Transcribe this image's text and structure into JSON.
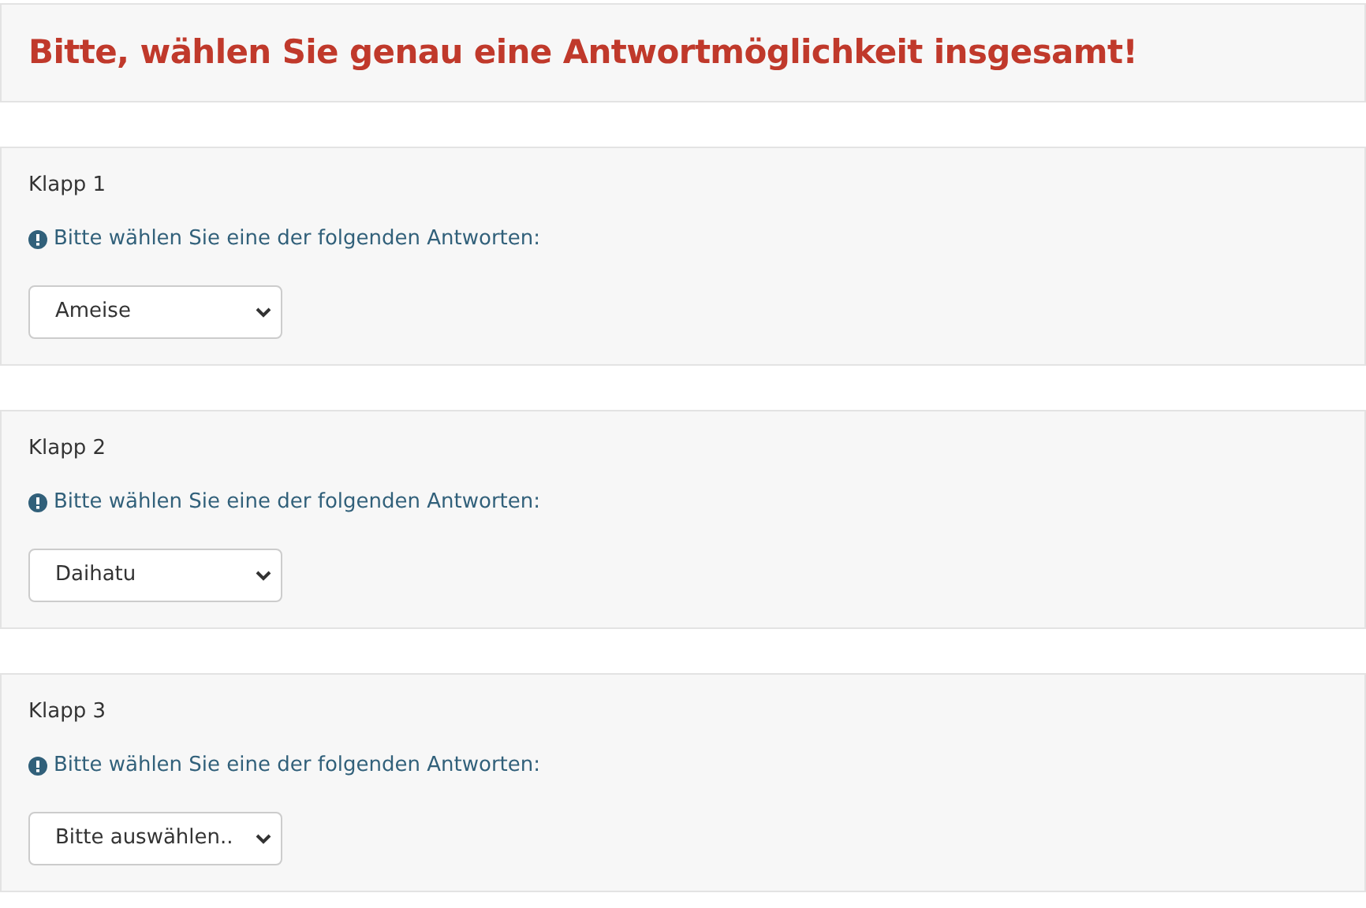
{
  "header": {
    "title": "Bitte, wählen Sie genau eine Antwortmöglichkeit insgesamt!"
  },
  "questions": [
    {
      "title": "Klapp 1",
      "hint": "Bitte wählen Sie eine der folgenden Antworten:",
      "value": "Ameise"
    },
    {
      "title": "Klapp 2",
      "hint": "Bitte wählen Sie eine der folgenden Antworten:",
      "value": "Daihatu"
    },
    {
      "title": "Klapp 3",
      "hint": "Bitte wählen Sie eine der folgenden Antworten:",
      "value": "Bitte auswählen.."
    }
  ]
}
